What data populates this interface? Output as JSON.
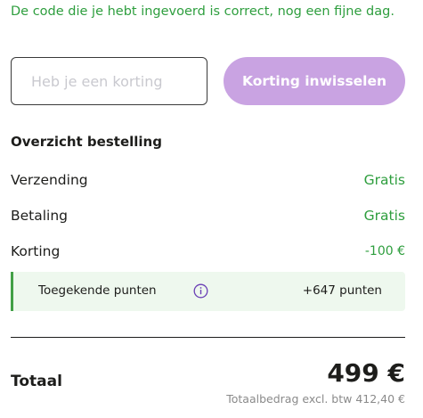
{
  "messages": {
    "success": "De code die je hebt ingevoerd is correct, nog een fijne dag."
  },
  "coupon": {
    "value": "",
    "placeholder": "Heb je een korting",
    "button_label": "Korting inwisselen"
  },
  "summary": {
    "title": "Overzicht bestelling",
    "rows": [
      {
        "label": "Verzending",
        "value": "Gratis"
      },
      {
        "label": "Betaling",
        "value": "Gratis"
      },
      {
        "label": "Korting",
        "value": "-100 €"
      }
    ],
    "points": {
      "label": "Toegekende punten",
      "icon": "info-icon",
      "value": "+647 punten"
    }
  },
  "total": {
    "label": "Totaal",
    "value": "499 €",
    "excl": "Totaalbedrag excl. btw 412,40 €"
  },
  "colors": {
    "success": "#2e9e3e",
    "accent_button": "#c9a3e2",
    "points_background": "#eef8ee",
    "points_border": "#43a047"
  }
}
